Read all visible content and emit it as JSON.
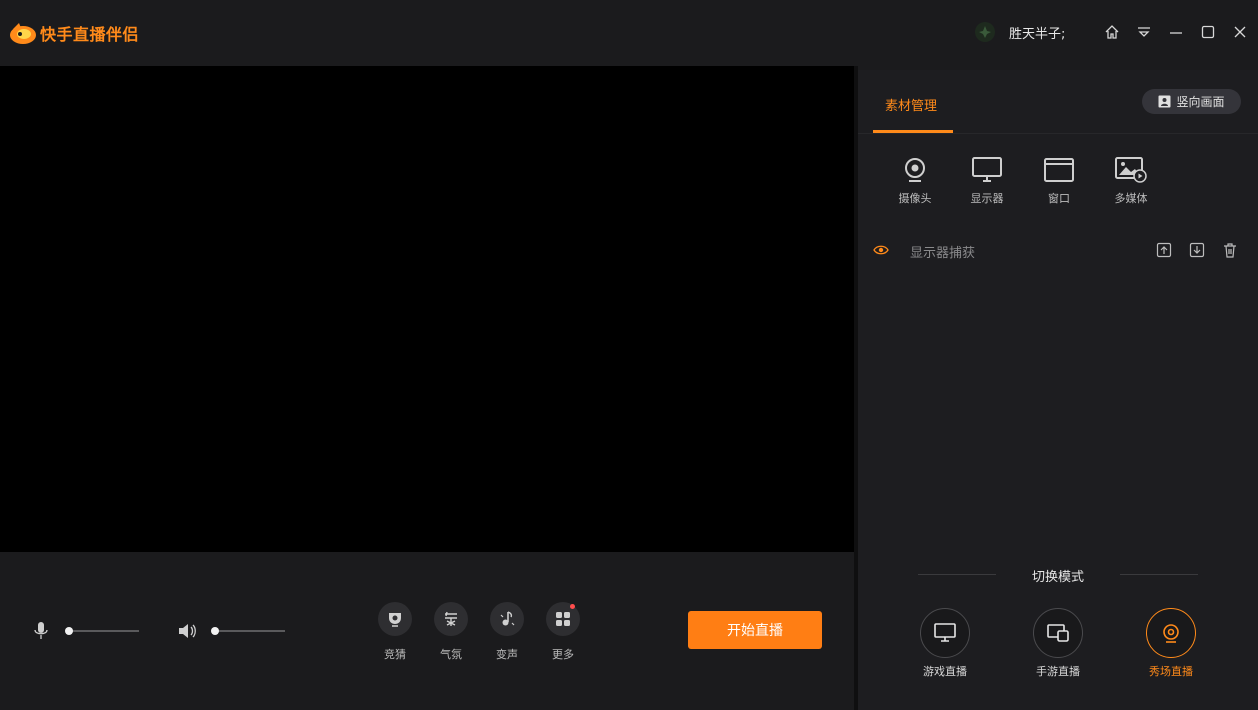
{
  "app": {
    "title": "快手直播伴侣",
    "brand_color": "#ff8a1a"
  },
  "user": {
    "name": "胜天半子;"
  },
  "window_controls": [
    "home-icon",
    "dropdown-icon",
    "minimize-icon",
    "maximize-icon",
    "close-icon"
  ],
  "tools": [
    {
      "label": "竞猜",
      "icon": "trophy-icon"
    },
    {
      "label": "气氛",
      "icon": "atmosphere-icon"
    },
    {
      "label": "变声",
      "icon": "music-note-icon"
    },
    {
      "label": "更多",
      "icon": "grid-icon"
    }
  ],
  "start_button": {
    "label": "开始直播",
    "color": "#ff7e14"
  },
  "panel": {
    "tab_label": "素材管理",
    "portrait_label": "竖向画面",
    "sources": [
      {
        "label": "摄像头",
        "icon": "camera-icon"
      },
      {
        "label": "显示器",
        "icon": "monitor-icon"
      },
      {
        "label": "窗口",
        "icon": "window-icon"
      },
      {
        "label": "多媒体",
        "icon": "media-icon"
      }
    ],
    "scene_item": {
      "name": "显示器捕获"
    },
    "mode_title": "切换模式",
    "modes": [
      {
        "label": "游戏直播",
        "icon": "desktop-icon",
        "active": false
      },
      {
        "label": "手游直播",
        "icon": "mobile-game-icon",
        "active": false
      },
      {
        "label": "秀场直播",
        "icon": "show-camera-icon",
        "active": true
      }
    ]
  }
}
